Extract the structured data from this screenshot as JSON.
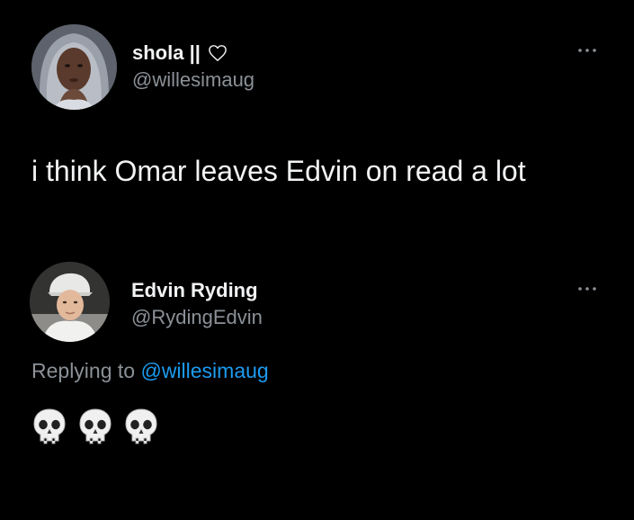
{
  "original_tweet": {
    "author": {
      "display_name": "shola ||",
      "handle": "@willesimaug",
      "badge_icon": "heart-outline-icon",
      "avatar_icon": "profile-photo"
    },
    "more_icon": "more-dots-icon",
    "text": "i think Omar leaves Edvin on read a lot"
  },
  "reply_tweet": {
    "author": {
      "display_name": "Edvin Ryding",
      "handle": "@RydingEdvin",
      "avatar_icon": "profile-photo"
    },
    "more_icon": "more-dots-icon",
    "replying_prefix": "Replying to",
    "replying_handle": "@willesimaug",
    "emojis": [
      "skull-icon",
      "skull-icon",
      "skull-icon"
    ]
  },
  "colors": {
    "background": "#000000",
    "primary_text": "#f2f3f4",
    "secondary_text": "#8b9197",
    "link": "#1d9bf0"
  }
}
